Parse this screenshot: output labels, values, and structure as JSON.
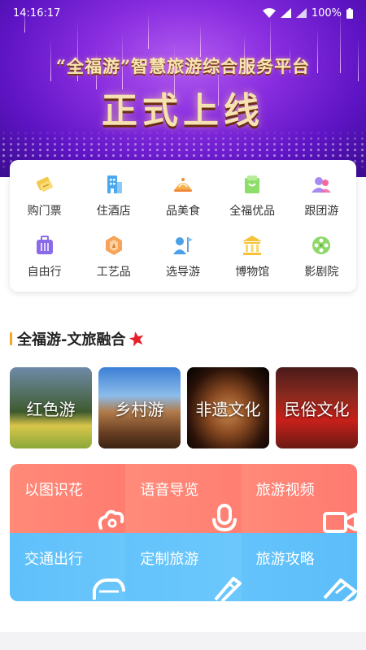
{
  "status_bar": {
    "time": "14:16:17",
    "battery": "100%"
  },
  "banner": {
    "subtitle": "“全福游”智慧旅游综合服务平台",
    "headline": "正式上线"
  },
  "categories": [
    {
      "label": "购门票",
      "icon": "ticket-icon"
    },
    {
      "label": "住酒店",
      "icon": "hotel-icon"
    },
    {
      "label": "品美食",
      "icon": "food-icon"
    },
    {
      "label": "全福优品",
      "icon": "shopping-bag-icon"
    },
    {
      "label": "跟团游",
      "icon": "tour-group-icon"
    },
    {
      "label": "自由行",
      "icon": "suitcase-icon"
    },
    {
      "label": "工艺品",
      "icon": "craft-icon"
    },
    {
      "label": "选导游",
      "icon": "guide-flag-icon"
    },
    {
      "label": "博物馆",
      "icon": "museum-icon"
    },
    {
      "label": "影剧院",
      "icon": "film-reel-icon"
    }
  ],
  "section": {
    "title": "全福游-文旅融合"
  },
  "culture": [
    {
      "label": "红色游"
    },
    {
      "label": "乡村游"
    },
    {
      "label": "非遗文化"
    },
    {
      "label": "民俗文化"
    }
  ],
  "services": [
    {
      "label": "以图识花",
      "icon": "flower-scan-icon"
    },
    {
      "label": "语音导览",
      "icon": "microphone-icon"
    },
    {
      "label": "旅游视频",
      "icon": "video-camera-icon"
    },
    {
      "label": "交通出行",
      "icon": "car-icon"
    },
    {
      "label": "定制旅游",
      "icon": "pen-icon"
    },
    {
      "label": "旅游攻略",
      "icon": "guide-book-icon"
    }
  ],
  "colors": {
    "accent_bar": "#f5a623",
    "service_warm": "#ff8a78",
    "service_cool": "#5fc0fb",
    "banner_purple": "#8a2ee0"
  }
}
